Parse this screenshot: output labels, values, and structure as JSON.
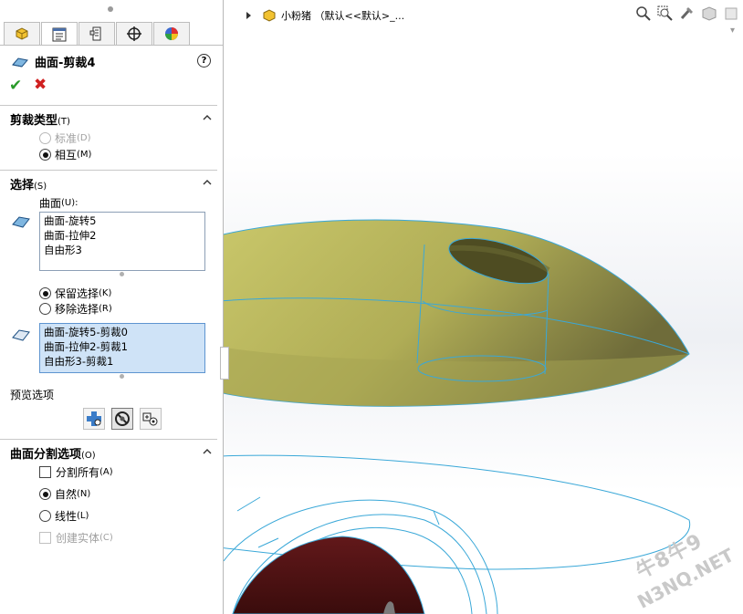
{
  "feature": {
    "title": "曲面-剪裁4",
    "help": "?"
  },
  "trim_type": {
    "header": "剪裁类型",
    "header_key": "(T)",
    "options": [
      {
        "label": "标准",
        "key": "(D)",
        "selected": false,
        "disabled": true
      },
      {
        "label": "相互",
        "key": "(M)",
        "selected": true,
        "disabled": false
      }
    ]
  },
  "selection": {
    "header": "选择",
    "header_key": "(S)",
    "surfaces_label": "曲面",
    "surfaces_key": "(U):",
    "surfaces": [
      "曲面-旋转5",
      "曲面-拉伸2",
      "自由形3"
    ],
    "keep": {
      "label": "保留选择",
      "key": "(K)",
      "selected": true
    },
    "remove": {
      "label": "移除选择",
      "key": "(R)",
      "selected": false
    },
    "pieces": [
      "曲面-旋转5-剪裁0",
      "曲面-拉伸2-剪裁1",
      "自由形3-剪裁1"
    ]
  },
  "preview": {
    "label": "预览选项"
  },
  "split": {
    "header": "曲面分割选项",
    "header_key": "(O)",
    "split_all": {
      "label": "分割所有",
      "key": "(A)",
      "checked": false
    },
    "natural": {
      "label": "自然",
      "key": "(N)",
      "selected": true
    },
    "linear": {
      "label": "线性",
      "key": "(L)",
      "selected": false
    },
    "create_solid": {
      "label": "创建实体",
      "key": "(C)",
      "checked": false,
      "disabled": true
    }
  },
  "viewport": {
    "breadcrumb": "小粉猪 （默认<<默认>_...",
    "watermark_line1": "牛8牛9",
    "watermark_line2": "N3NQ.NET"
  },
  "icons": [
    "part-icon",
    "property-manager-icon",
    "config-icon",
    "target-icon",
    "appearance-icon",
    "trim-surface-icon",
    "zoom-fit-icon",
    "zoom-area-icon",
    "previous-view-icon",
    "section-view-icon"
  ],
  "colors": {
    "surface": "#b8b45c",
    "edge": "#3aa8d8",
    "dark_surface": "#5a1414",
    "selection": "#cfe3f7"
  }
}
